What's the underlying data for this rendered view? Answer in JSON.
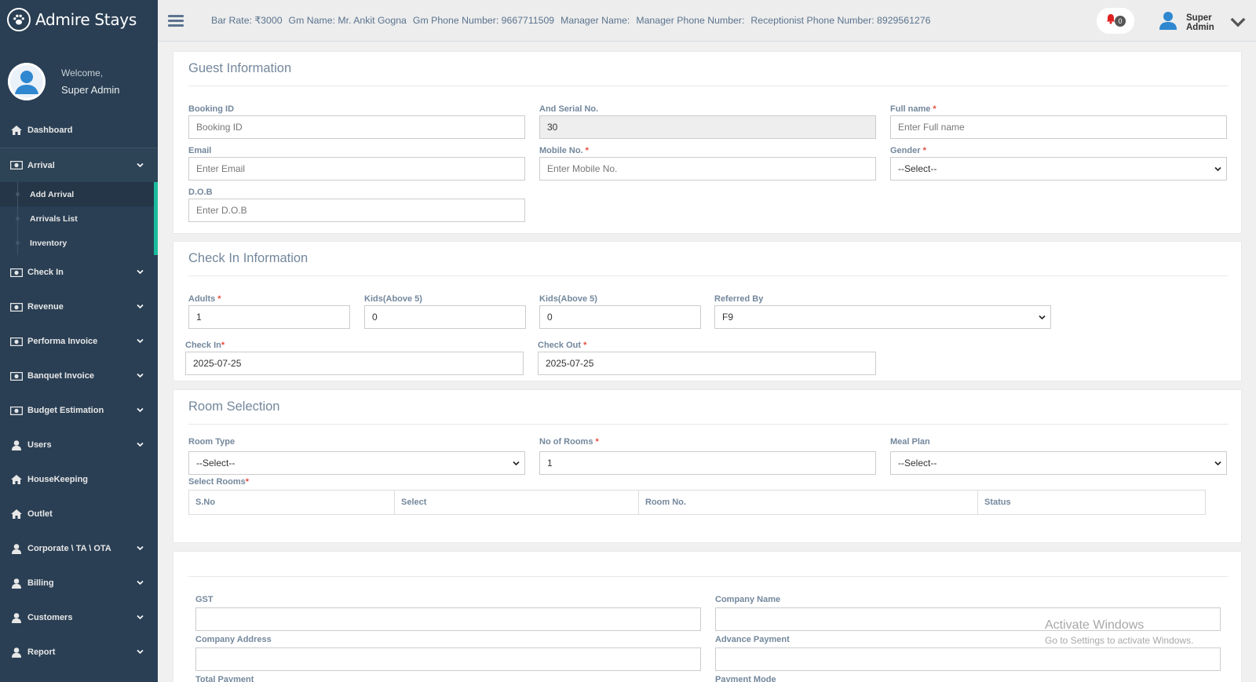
{
  "brand": {
    "name": "Admire Stays"
  },
  "profile": {
    "welcome": "Welcome,",
    "name": "Super Admin"
  },
  "menu": {
    "dashboard": "Dashboard",
    "arrival": "Arrival",
    "arrival_sub": [
      "Add Arrival",
      "Arrivals List",
      "Inventory"
    ],
    "check_in": "Check In",
    "revenue": "Revenue",
    "performa_invoice": "Performa Invoice",
    "banquet_invoice": "Banquet Invoice",
    "budget_estimation": "Budget Estimation",
    "users": "Users",
    "housekeeping": "HouseKeeping",
    "outlet": "Outlet",
    "corporate": "Corporate \\ TA \\ OTA",
    "billing": "Billing",
    "customers": "Customers",
    "report": "Report"
  },
  "topbar": {
    "bar_rate": "Bar Rate: ₹3000",
    "gm_name": "Gm Name: Mr. Ankit Gogna",
    "gm_phone": "Gm Phone Number: 9667711509",
    "manager_name": "Manager Name:",
    "manager_phone": "Manager Phone Number:",
    "receptionist_phone": "Receptionist Phone Number: 8929561276",
    "notification_count": "0",
    "user_name": "Super Admin"
  },
  "guest_info": {
    "title": "Guest Information",
    "booking_id": {
      "label": "Booking ID",
      "placeholder": "Booking ID"
    },
    "serial_no": {
      "label": "And Serial No.",
      "value": "30"
    },
    "full_name": {
      "label": "Full name",
      "placeholder": "Enter Full name"
    },
    "email": {
      "label": "Email",
      "placeholder": "Enter Email"
    },
    "mobile": {
      "label": "Mobile No.",
      "placeholder": "Enter Mobile No."
    },
    "gender": {
      "label": "Gender",
      "value": "--Select--"
    },
    "dob": {
      "label": "D.O.B",
      "placeholder": "Enter D.O.B"
    }
  },
  "check_in_info": {
    "title": "Check In Information",
    "adults": {
      "label": "Adults",
      "value": "1"
    },
    "kids1": {
      "label": "Kids(Above 5)",
      "value": "0"
    },
    "kids2": {
      "label": "Kids(Above 5)",
      "value": "0"
    },
    "referred_by": {
      "label": "Referred By",
      "value": "F9"
    },
    "check_in": {
      "label": "Check In",
      "value": "2025-07-25"
    },
    "check_out": {
      "label": "Check Out",
      "value": "2025-07-25"
    }
  },
  "room_selection": {
    "title": "Room Selection",
    "room_type": {
      "label": "Room Type",
      "value": "--Select--"
    },
    "no_of_rooms": {
      "label": "No of Rooms",
      "value": "1"
    },
    "meal_plan": {
      "label": "Meal Plan",
      "value": "--Select--"
    },
    "select_rooms_label": "Select Rooms",
    "table_headers": [
      "S.No",
      "Select",
      "Room No.",
      "Status"
    ]
  },
  "billing_section": {
    "gst": "GST",
    "company_name": "Company Name",
    "company_address": "Company Address",
    "advance_payment": "Advance Payment",
    "total_payment": "Total Payment",
    "payment_mode": "Payment Mode"
  },
  "watermark": {
    "line1": "Activate Windows",
    "line2": "Go to Settings to activate Windows."
  },
  "colors": {
    "sidebar": "#2a3f54",
    "accent": "#1abb9c",
    "required": "#e74c3c",
    "icon_blue": "#2f87d0"
  }
}
